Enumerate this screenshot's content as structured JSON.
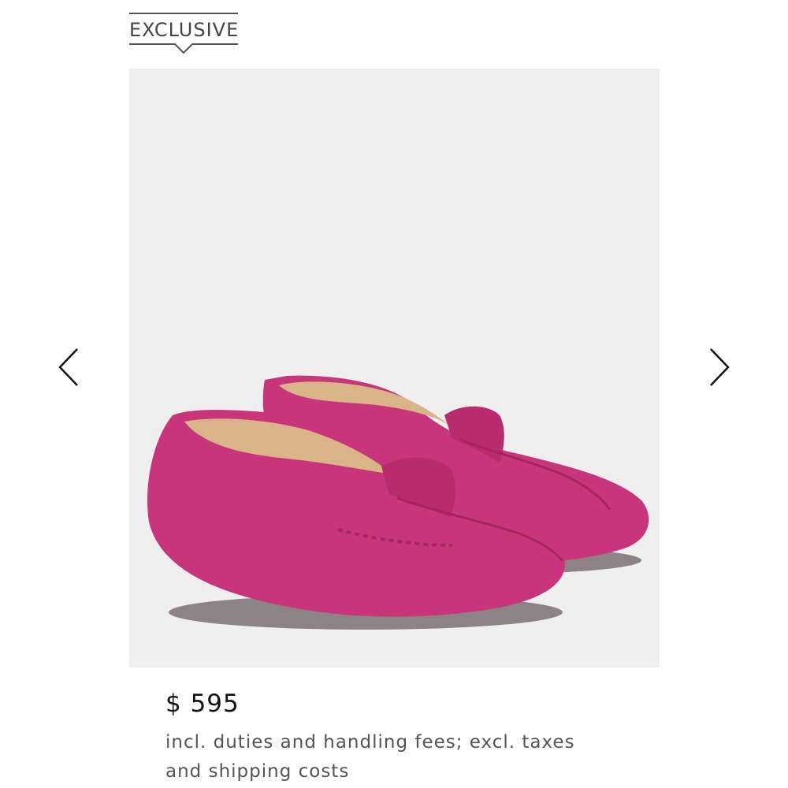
{
  "badge": {
    "label": "EXCLUSIVE"
  },
  "gallery": {
    "image_alt": "pink suede loafers",
    "background_color": "#efefef",
    "shoe_color": "#c8357b",
    "prev_icon": "chevron-left-icon",
    "next_icon": "chevron-right-icon"
  },
  "product": {
    "price": "$ 595",
    "price_note_line1": "incl. duties and handling fees; excl. taxes",
    "price_note_line2": "and shipping costs"
  }
}
